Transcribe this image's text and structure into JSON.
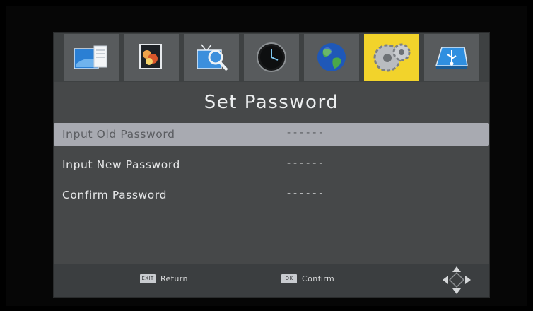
{
  "menu": {
    "tabs": [
      {
        "name": "program-icon",
        "active": false
      },
      {
        "name": "picture-icon",
        "active": false
      },
      {
        "name": "channel-search-icon",
        "active": false
      },
      {
        "name": "clock-icon",
        "active": false
      },
      {
        "name": "globe-icon",
        "active": false
      },
      {
        "name": "settings-gears-icon",
        "active": true
      },
      {
        "name": "usb-icon",
        "active": false
      }
    ]
  },
  "page": {
    "title": "Set Password"
  },
  "fields": [
    {
      "label": "Input Old Password",
      "value": "------"
    },
    {
      "label": "Input New Password",
      "value": "------"
    },
    {
      "label": "Confirm Password",
      "value": "------"
    }
  ],
  "footer": {
    "return_key": "EXIT",
    "return_label": "Return",
    "confirm_key": "OK",
    "confirm_label": "Confirm"
  },
  "colors": {
    "panel": "#464849",
    "active_tab": "#f2d32b",
    "selected_row": "#a8aab1"
  }
}
